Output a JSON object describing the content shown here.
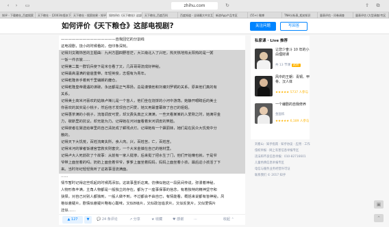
{
  "browser": {
    "url": "zhihu.com",
    "tabs": [
      "知乎 - 下载粮仓_百度搜索",
      "天下粮仓 -【2003年版本下载",
      "天下粮仓 - 搜索结果 - 知乎",
      "如何评价《天下粮仓》这部",
      "天下粮仓_百度百科",
      "百度知道 - 全球最大中文互动",
      "新浪App产品专区",
      "(55+) 微博",
      "TNH分析表_相关知识",
      "量表评估 - 问卷调查",
      "量表评估 (大型调查)专区"
    ]
  },
  "header": {
    "title": "如何评价《天下粮仓》这部电视剧?",
    "follow_label": "关注问题",
    "answer_label": "写回答"
  },
  "answer": {
    "lines": [
      {
        "text": "———————————————自我回忆的分割线",
        "highlight": false
      },
      {
        "text": "这电视剧，饶小的时候看的，但印象深刻。",
        "highlight": false
      },
      {
        "text": "记得刘文聘饰苦的主题曲：九州方圆四野苍茫，大江南北入了兴旺，热天热地热太阳热的是一粥",
        "highlight": true
      },
      {
        "text": "一饭一件衣裳……",
        "highlight": true
      },
      {
        "text": "记得第二集一群饥兵使下是米仓看了又，几百哥哥流成好神秘。",
        "highlight": true
      },
      {
        "text": "记得最高温满的爸爸重带，年轻英俊，志倔有为青年。",
        "highlight": true
      },
      {
        "text": "记得乾隆亲手着到千里辅朗的魔仓。",
        "highlight": true
      },
      {
        "text": "记得乾隆皇帝遭遇的谋破，永远都是正气昂扬，总是谨慎他和刘墉刘罗锅的关系，原来他们真的有",
        "highlight": true
      },
      {
        "text": "关系。",
        "highlight": true
      },
      {
        "text": "记得美士高米河喜欢的姑娘卢禅儿是一个盲人，他们坐在烧饼的小河中游荡。她静开眼睛后的美士",
        "highlight": true
      },
      {
        "text": "你喜欢的其实是小桃子，然后他才发现自己问爱，她又用最害幕嫁了自己的姐姐。",
        "highlight": true
      },
      {
        "text": "记得惠茶满的小桃子，流落调皮可爱，却又费失真正义满满，一些天看某某的人爱刚之时，她满尽金",
        "highlight": true
      },
      {
        "text": "力，歇斯里的抗议，却无能为力。记得她在河对面看着米河调皮的笑脸。",
        "highlight": true
      },
      {
        "text": "记得彼者在舅送给审里的自己清抚成了鳏残点灯。记得她有一个飘丽妹，她们是在民众大饥荒中分",
        "highlight": true
      },
      {
        "text": "散的。",
        "highlight": true
      },
      {
        "text": "记得天下大饥荒，百姓流离失所，食人肉。兴，百姓苦，亡，百姓苦。",
        "highlight": true
      },
      {
        "text": "记得米河的掌者饭谨官营救实则害灾，一个大米金镇在自己的棺材里。",
        "highlight": true
      },
      {
        "text": "记得卢大人死前砍了个故事：从前有一家人挺惨，后来挺了把水生了门，他们开始懒也就，于是爷",
        "highlight": true
      },
      {
        "text": "爷带上面坐着的吗，奶奶上面坐着爷爷，爹爹上面坐着妈妈，妈妈上面坐着小孩，最后这小孩活了下",
        "highlight": true
      },
      {
        "text": "来。当时年纪轻轻我听了这故事泪流满面。",
        "highlight": true
      },
      {
        "text": "……",
        "highlight": false
      },
      {
        "text": "情节暂时记得这些现起的时候再添加。这故事虽折这离。仿佛似抱这一段民间传说，弥漫着神秘，",
        "highlight": false
      },
      {
        "text": "人物形像丰满，主角人物都是一般独立的存在。都为了一座事保事的信念，有着独特的精神坚守和",
        "highlight": false
      },
      {
        "text": "抉择。对自己对别人都独到，一般人做不到，不过都会不由自已，有情能看。概括来说都有皆神秘。风",
        "highlight": false
      },
      {
        "text": "格似悬疑片，剧情似悬疑片略有心酸味，又似B级片，又似政治追求片，又似反复片，又似爱情片",
        "highlight": false
      },
      {
        "text": "还似……",
        "highlight": false
      }
    ],
    "vote_label": "▲ 127",
    "down_label": "▼",
    "comments_label": "24 条评论",
    "share_label": "分享",
    "collect_label": "收藏",
    "thanks_label": "感谢",
    "more_label": "···",
    "collapse_label": "收起 ⌃"
  },
  "sidebar": {
    "title": "私家课 · Live 推荐",
    "lives": [
      {
        "title": "让您少奋斗 10 年的小白理财课",
        "meta": "共 13 节课",
        "badge": "试听",
        "rating": ""
      },
      {
        "title": "风中的王朝：青铜、甲骨、汉人体",
        "meta": "",
        "badge": "",
        "rating": "★★★★★ 5737 人参与"
      },
      {
        "title": "一个编剧的自我修养",
        "meta": "金国栋",
        "badge": "",
        "rating": "★★★★★ 6,189 人参与"
      }
    ]
  },
  "footer": {
    "lines": [
      "刘看山 · 知乎指南 · 知乎协议 · 应用 · 工作",
      "侵权举报 · 网上有害信息举报专区",
      "违法和不良信息举报：010-82716601",
      "儿童色情信息举报专区",
      "电信与服务业务经营许可证",
      "联系我们 © 2017 知乎"
    ]
  },
  "colors": {
    "accent": "#0084ff",
    "highlight": "#d5d5d5",
    "meta": "#8590a6"
  }
}
